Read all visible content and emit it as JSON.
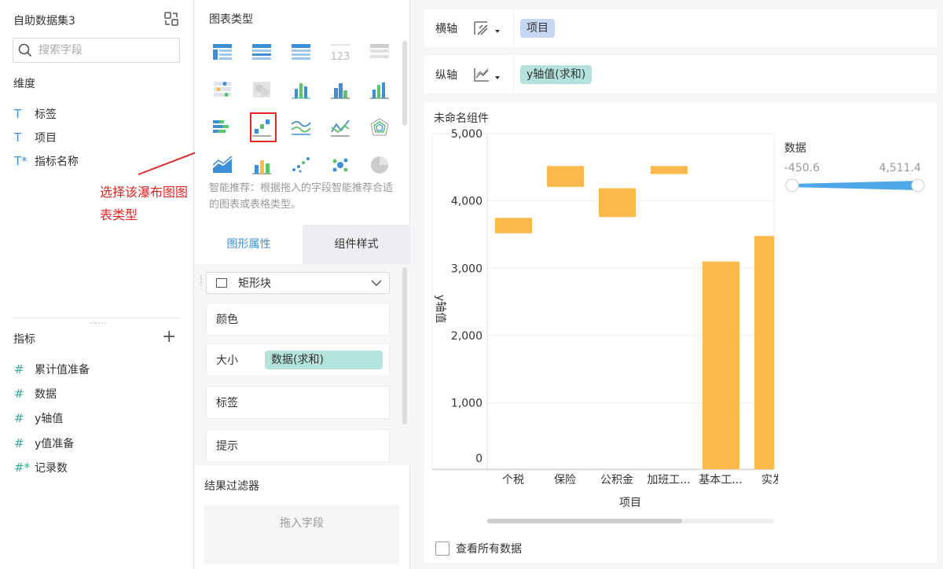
{
  "sidebar": {
    "dataset_title": "自助数据集3",
    "search_placeholder": "搜索字段",
    "dimension_label": "维度",
    "dimensions": [
      {
        "icon": "T",
        "label": "标签"
      },
      {
        "icon": "T",
        "label": "项目"
      },
      {
        "icon": "T*",
        "label": "指标名称"
      }
    ],
    "measure_label": "指标",
    "measures": [
      {
        "icon": "#",
        "label": "累计值准备"
      },
      {
        "icon": "#",
        "label": "数据"
      },
      {
        "icon": "#",
        "label": "y轴值"
      },
      {
        "icon": "#",
        "label": "y值准备"
      },
      {
        "icon": "#*",
        "label": "记录数"
      }
    ]
  },
  "annotation": {
    "text": "选择该瀑布图图表类型",
    "color": "#e12626"
  },
  "chart_types": {
    "title": "图表类型",
    "hint": "智能推荐：根据拖入的字段智能推荐合适的图表或表格类型。",
    "selected": "waterfall-chart"
  },
  "tabs": [
    {
      "label": "图形属性",
      "active": true
    },
    {
      "label": "组件样式",
      "active": false
    }
  ],
  "properties": {
    "shape_select": "矩形块",
    "items": [
      {
        "label": "颜色"
      },
      {
        "label": "大小",
        "pill": "数据(求和)"
      },
      {
        "label": "标签"
      },
      {
        "label": "提示"
      }
    ]
  },
  "filter": {
    "title": "结果过滤器",
    "drop_hint": "拖入字段"
  },
  "axes": {
    "x_label": "横轴",
    "x_field": "项目",
    "y_label": "纵轴",
    "y_field": "y轴值(求和)"
  },
  "widget": {
    "title": "未命名组件",
    "show_all": "查看所有数据",
    "legend_title": "数据",
    "legend_min": "-450.6",
    "legend_max": "4,511.4"
  },
  "chart_data": {
    "type": "bar",
    "subtype": "waterfall",
    "xlabel": "项目",
    "ylabel": "y轴值",
    "ylim": [
      -200,
      5000
    ],
    "yticks": [
      "5,000",
      "4,000",
      "3,000",
      "2,000",
      "1,000",
      "0"
    ],
    "categories": [
      "个税",
      "保险",
      "公积金",
      "加班工...",
      "基本工...",
      "实发"
    ],
    "bars": [
      {
        "low": 3520,
        "high": 3750
      },
      {
        "low": 4210,
        "high": 4520
      },
      {
        "low": 3760,
        "high": 4190
      },
      {
        "low": 4400,
        "high": 4520
      },
      {
        "low": -200,
        "high": 3100
      },
      {
        "low": -200,
        "high": 3480
      }
    ],
    "bar_color": "#fcb94c",
    "grid": true
  }
}
